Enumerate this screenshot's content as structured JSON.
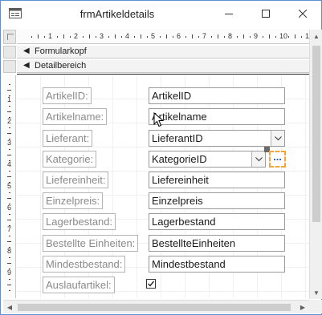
{
  "window": {
    "title": "frmArtikeldetails",
    "minimize_icon": "minimize-icon",
    "maximize_icon": "maximize-icon",
    "close_icon": "close-icon"
  },
  "ruler": {
    "horizontal_numbers": [
      "1",
      "2",
      "3",
      "4",
      "5",
      "6",
      "7",
      "8",
      "9",
      "10",
      "11"
    ],
    "vertical_numbers": [
      "1",
      "2",
      "3",
      "4",
      "5",
      "6",
      "7",
      "8",
      "9"
    ]
  },
  "sections": {
    "header": {
      "label": "Formularkopf",
      "icon": "section-arrow-icon"
    },
    "detail": {
      "label": "Detailbereich",
      "icon": "section-arrow-icon"
    }
  },
  "fields": [
    {
      "label": "ArtikelID:",
      "control": "ArtikelID",
      "type": "text"
    },
    {
      "label": "Artikelname:",
      "control": "Artikelname",
      "type": "text"
    },
    {
      "label": "Lieferant:",
      "control": "LieferantID",
      "type": "combo"
    },
    {
      "label": "Kategorie:",
      "control": "KategorieID",
      "type": "combo"
    },
    {
      "label": "Liefereinheit:",
      "control": "Liefereinheit",
      "type": "text"
    },
    {
      "label": "Einzelpreis:",
      "control": "Einzelpreis",
      "type": "text"
    },
    {
      "label": "Lagerbestand:",
      "control": "Lagerbestand",
      "type": "text"
    },
    {
      "label": "Bestellte Einheiten:",
      "control": "BestellteEinheiten",
      "type": "text"
    },
    {
      "label": "Mindestbestand:",
      "control": "Mindestbestand",
      "type": "text"
    },
    {
      "label": "Auslaufartikel:",
      "control": "",
      "type": "checkbox",
      "checked": true
    }
  ],
  "ellipsis_button": {
    "label": "...",
    "selection_color": "#f7a33a"
  },
  "colors": {
    "label_text": "#8a8a8a",
    "window_border": "#5b8fd6",
    "ellipsis": "#1f5fbf"
  }
}
